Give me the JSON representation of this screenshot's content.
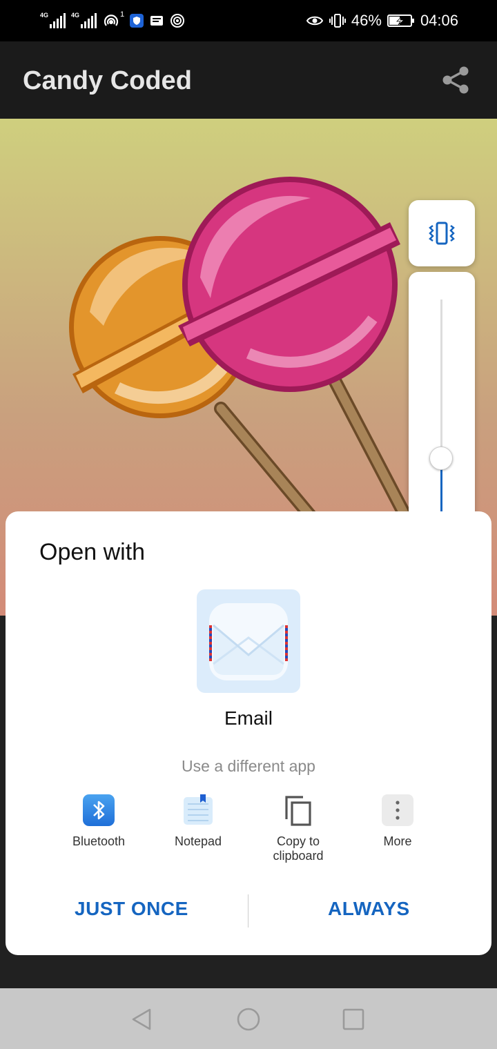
{
  "status_bar": {
    "signal_1_label": "4G",
    "signal_2_label": "4G",
    "notification_count": "1",
    "battery_percent": "46%",
    "time": "04:06"
  },
  "app_bar": {
    "title": "Candy Coded",
    "share_icon": "share-icon"
  },
  "volume_panel": {
    "vibrate_icon": "vibrate-icon",
    "music_icon": "music-note-icon",
    "settings_icon": "gear-icon",
    "volume_level": 0.28
  },
  "sheet": {
    "title": "Open with",
    "default_app": {
      "name": "Email",
      "icon": "email-icon"
    },
    "different_app_label": "Use a different app",
    "share_options": [
      {
        "label": "Bluetooth",
        "icon": "bluetooth-icon"
      },
      {
        "label": "Notepad",
        "icon": "notepad-icon"
      },
      {
        "label": "Copy to clipboard",
        "icon": "copy-icon"
      },
      {
        "label": "More",
        "icon": "more-icon"
      }
    ],
    "just_once_label": "JUST ONCE",
    "always_label": "ALWAYS"
  },
  "nav_bar": {
    "back_icon": "back-icon",
    "home_icon": "home-icon",
    "recents_icon": "recents-icon"
  },
  "colors": {
    "accent": "#1565c0",
    "app_bar_bg": "#1b1b1b",
    "lollipop_pink": "#d6367f",
    "lollipop_orange": "#e3952c"
  }
}
